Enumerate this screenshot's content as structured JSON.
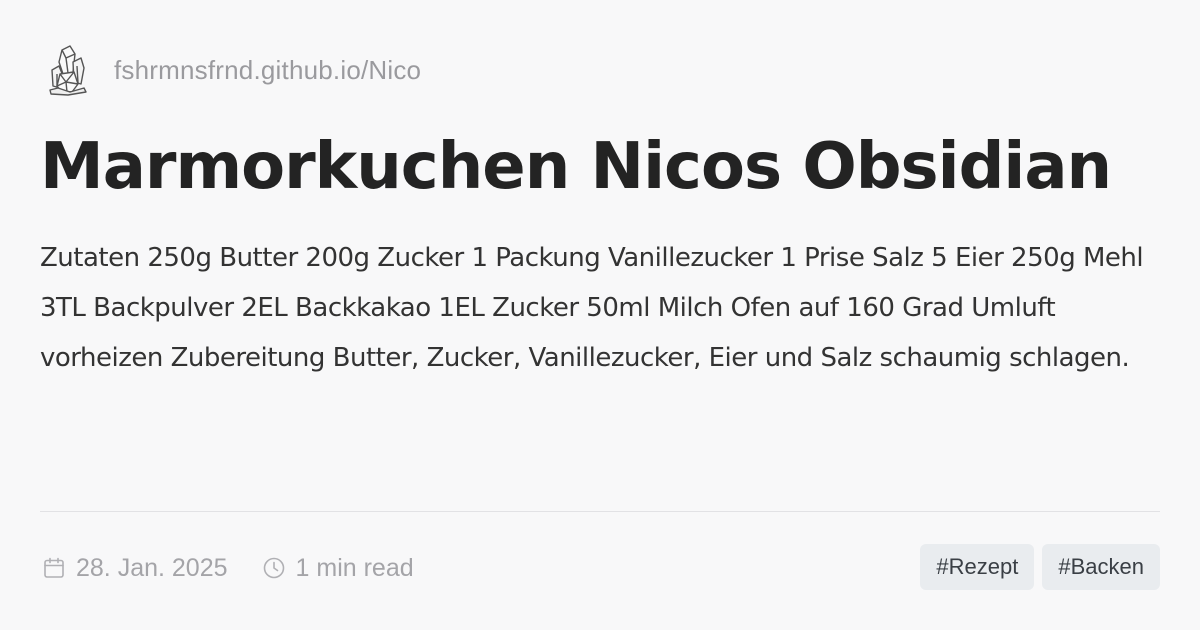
{
  "site": {
    "logo_icon": "crystal-logo-icon",
    "url": "fshrmnsfrnd.github.io/Nico"
  },
  "post": {
    "title": "Marmorkuchen Nicos Obsidian",
    "excerpt": "Zutaten 250g Butter 200g Zucker 1 Packung Vanillezucker 1 Prise Salz 5 Eier 250g Mehl 3TL Backpulver 2EL Backkakao 1EL Zucker 50ml Milch Ofen auf 160 Grad Umluft vorheizen Zubereitung Butter, Zucker, Vanillezucker, Eier und Salz schaumig schlagen."
  },
  "meta": {
    "date_icon": "calendar-icon",
    "date": "28. Jan. 2025",
    "read_icon": "clock-icon",
    "reading_time": "1 min read"
  },
  "tags": [
    {
      "label": "#Rezept"
    },
    {
      "label": "#Backen"
    }
  ],
  "colors": {
    "background": "#f8f8f9",
    "title": "#232323",
    "muted": "#9a9a9e",
    "tag_background": "#e9ecef"
  }
}
